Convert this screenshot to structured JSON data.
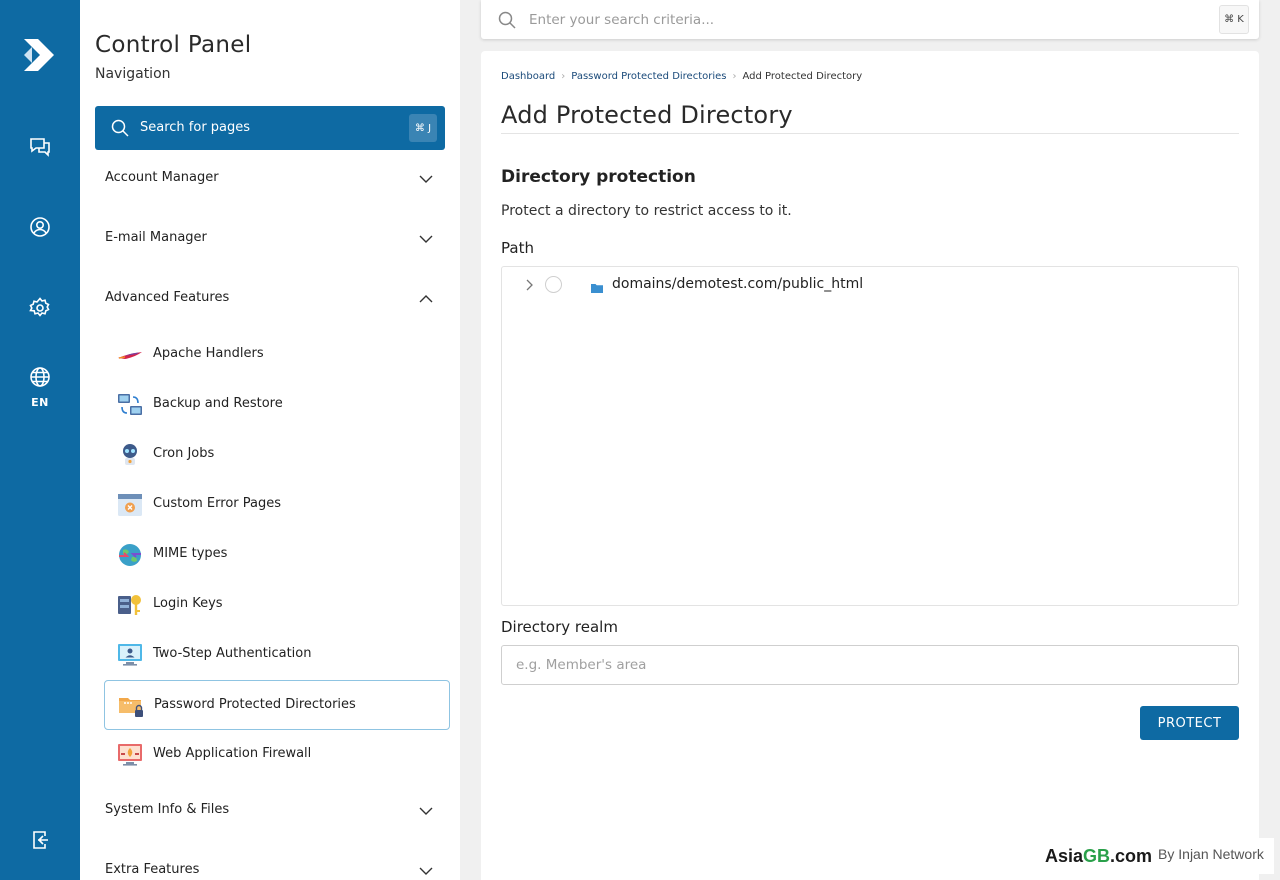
{
  "rail": {
    "lang": "EN"
  },
  "sidebar": {
    "title": "Control Panel",
    "subtitle": "Navigation",
    "search_label": "Search for pages",
    "search_shortcut": "⌘ J",
    "sections": [
      {
        "label": "Account Manager",
        "expanded": false
      },
      {
        "label": "E-mail Manager",
        "expanded": false
      },
      {
        "label": "Advanced Features",
        "expanded": true
      },
      {
        "label": "System Info & Files",
        "expanded": false
      },
      {
        "label": "Extra Features",
        "expanded": false
      }
    ],
    "advanced_items": [
      {
        "label": "Apache Handlers",
        "icon": "feather-icon"
      },
      {
        "label": "Backup and Restore",
        "icon": "backup-computers-icon"
      },
      {
        "label": "Cron Jobs",
        "icon": "robot-icon"
      },
      {
        "label": "Custom Error Pages",
        "icon": "error-window-icon"
      },
      {
        "label": "MIME types",
        "icon": "globe-arrows-icon"
      },
      {
        "label": "Login Keys",
        "icon": "key-icon"
      },
      {
        "label": "Two-Step Authentication",
        "icon": "monitor-user-icon"
      },
      {
        "label": "Password Protected Directories",
        "icon": "locked-folder-icon",
        "active": true
      },
      {
        "label": "Web Application Firewall",
        "icon": "firewall-monitor-icon"
      }
    ]
  },
  "topbar": {
    "search_placeholder": "Enter your search criteria...",
    "search_shortcut": "⌘ K"
  },
  "main": {
    "breadcrumb": [
      "Dashboard",
      "Password Protected Directories",
      "Add Protected Directory"
    ],
    "title": "Add Protected Directory",
    "section_title": "Directory protection",
    "section_desc": "Protect a directory to restrict access to it.",
    "path_label": "Path",
    "tree_root": "domains/demotest.com/public_html",
    "realm_label": "Directory realm",
    "realm_placeholder": "e.g. Member's area",
    "realm_value": "",
    "protect_button": "PROTECT"
  },
  "watermark": {
    "asia": "Asia",
    "gb": "GB",
    "com": ".com",
    "by": "By Injan Network"
  },
  "colors": {
    "brand_blue": "#0e6aa3",
    "active_border": "#8fc4e2",
    "watermark_green": "#2aa04a"
  }
}
